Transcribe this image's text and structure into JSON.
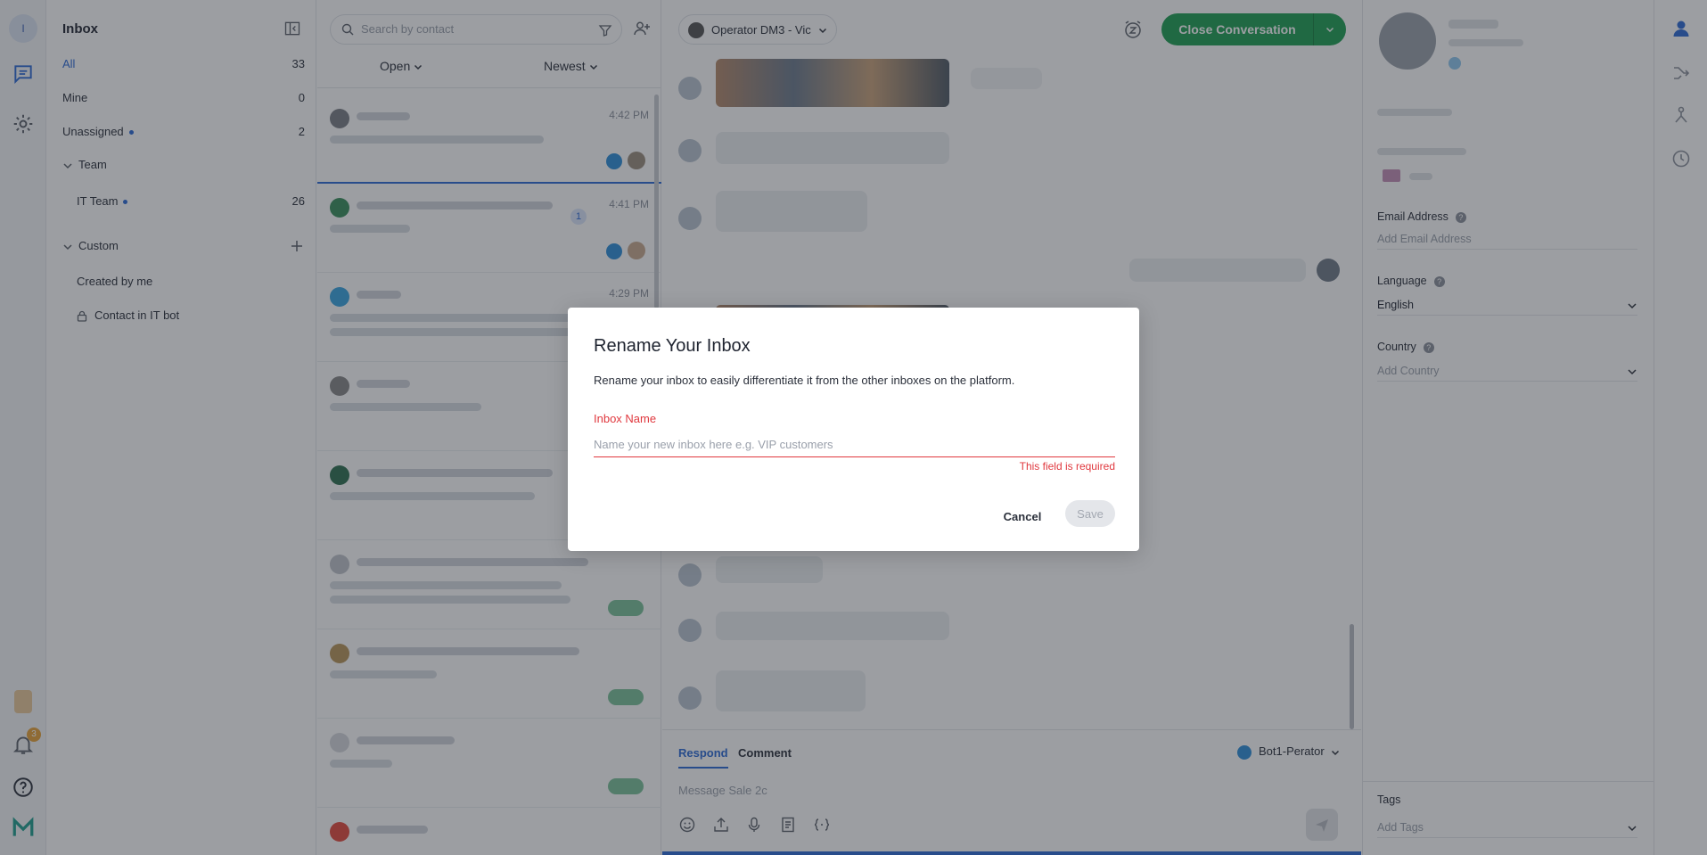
{
  "rail": {
    "user_initial": "I",
    "notification_count": "3"
  },
  "sidebar": {
    "title": "Inbox",
    "items": [
      {
        "label": "All",
        "count": "33"
      },
      {
        "label": "Mine",
        "count": "0"
      },
      {
        "label": "Unassigned",
        "count": "2"
      }
    ],
    "team_header": "Team",
    "team_items": [
      {
        "label": "IT Team",
        "count": "26"
      }
    ],
    "custom_header": "Custom",
    "custom_items": [
      {
        "label": "Created by me"
      },
      {
        "label": "Contact in IT bot"
      }
    ]
  },
  "list": {
    "search_placeholder": "Search by contact",
    "status_filter": "Open",
    "sort_filter": "Newest",
    "conversations": [
      {
        "time": "4:42 PM"
      },
      {
        "time": "4:41 PM",
        "unread": "1"
      },
      {
        "time": "4:29 PM"
      }
    ]
  },
  "chat": {
    "operator": "Operator DM3 - Vic",
    "close_label": "Close Conversation",
    "tab_respond": "Respond",
    "tab_comment": "Comment",
    "bot": "Bot1-Perator",
    "message_placeholder": "Message Sale 2c"
  },
  "contact": {
    "email_label": "Email Address",
    "email_placeholder": "Add Email Address",
    "language_label": "Language",
    "language_value": "English",
    "country_label": "Country",
    "country_placeholder": "Add Country",
    "tags_label": "Tags",
    "tags_placeholder": "Add Tags"
  },
  "modal": {
    "title": "Rename Your Inbox",
    "description": "Rename your inbox to easily differentiate it from the other inboxes on the platform.",
    "field_label": "Inbox Name",
    "field_placeholder": "Name your new inbox here e.g. VIP customers",
    "error": "This field is required",
    "cancel": "Cancel",
    "save": "Save"
  },
  "colors": {
    "accent": "#2c6ad6",
    "success": "#1e9e52",
    "error": "#e0383e"
  }
}
